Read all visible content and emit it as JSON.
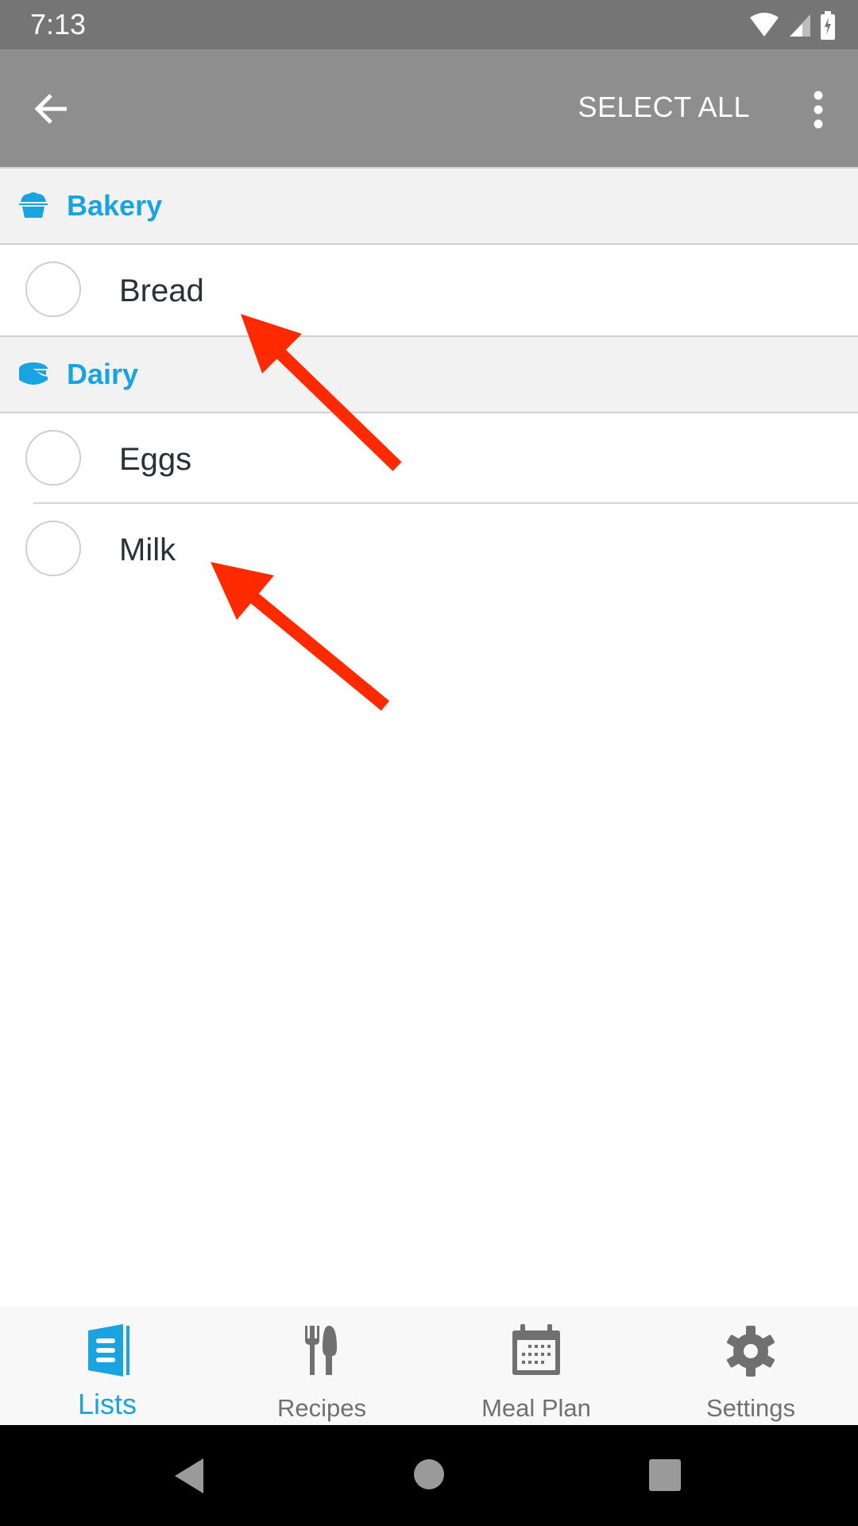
{
  "status_bar": {
    "time": "7:13",
    "icons": [
      "wifi-icon",
      "signal-icon",
      "battery-charging-icon"
    ]
  },
  "app_bar": {
    "back_icon": "arrow-back-icon",
    "select_all_label": "SELECT ALL",
    "more_icon": "more-vert-icon"
  },
  "categories": [
    {
      "name": "Bakery",
      "icon": "cupcake-icon",
      "items": [
        {
          "label": "Bread",
          "checked": false
        }
      ]
    },
    {
      "name": "Dairy",
      "icon": "cheese-icon",
      "items": [
        {
          "label": "Eggs",
          "checked": false
        },
        {
          "label": "Milk",
          "checked": false
        }
      ]
    }
  ],
  "bottom_nav": {
    "tabs": [
      {
        "label": "Lists",
        "icon": "lists-icon",
        "active": true
      },
      {
        "label": "Recipes",
        "icon": "fork-spoon-icon",
        "active": false
      },
      {
        "label": "Meal Plan",
        "icon": "calendar-icon",
        "active": false
      },
      {
        "label": "Settings",
        "icon": "gear-icon",
        "active": false
      }
    ]
  },
  "colors": {
    "accent": "#1aa3e1",
    "app_bar": "#8e8e8e",
    "status_bar": "#757575",
    "annotation_arrow": "#ff2a00",
    "item_text": "#263238"
  },
  "annotations": [
    {
      "type": "arrow",
      "points_to": "Bread"
    },
    {
      "type": "arrow",
      "points_to": "Milk"
    }
  ]
}
